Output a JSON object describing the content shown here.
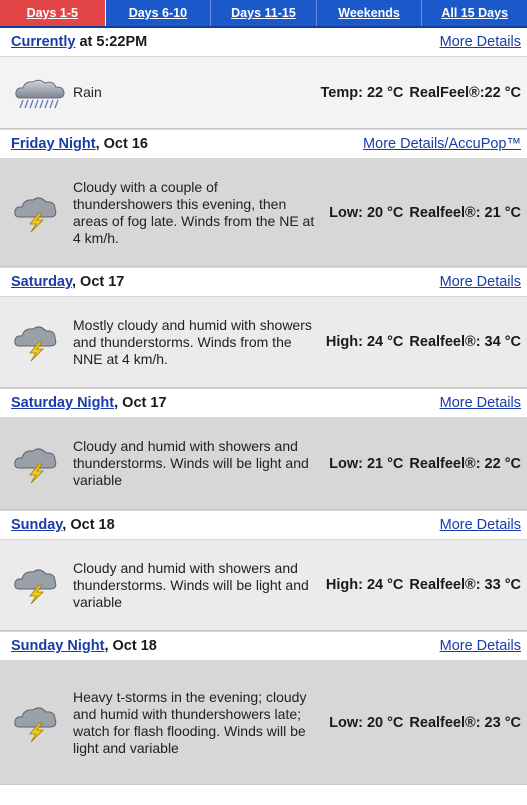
{
  "tabs": [
    {
      "label": "Days 1-5",
      "active": true
    },
    {
      "label": "Days 6-10"
    },
    {
      "label": "Days 11-15"
    },
    {
      "label": "Weekends"
    },
    {
      "label": "All 15 Days"
    }
  ],
  "current": {
    "link": "Currently",
    "time": " at 5:22PM",
    "more": "More Details",
    "icon": "rain-cloud-icon",
    "desc": "Rain",
    "temp": "Temp: 22 °C",
    "realfeel": "RealFeel®:22 °C"
  },
  "periods": [
    {
      "name": "Friday Night",
      "date": ", Oct 16",
      "more": "More Details/AccuPop™",
      "icon": "thunderstorm-cloud-icon",
      "desc": "Cloudy with a couple of thundershowers this evening, then areas of fog late. Winds from the NE at 4 km/h.",
      "temp": "Low: 20 °C",
      "realfeel": "Realfeel®: 21 °C"
    },
    {
      "name": "Saturday",
      "date": ", Oct 17",
      "more": "More Details",
      "icon": "thunderstorm-cloud-icon",
      "desc": "Mostly cloudy and humid with showers and thunderstorms. Winds from the NNE at 4 km/h.",
      "temp": "High: 24 °C",
      "realfeel": "Realfeel®: 34 °C"
    },
    {
      "name": "Saturday Night",
      "date": ", Oct 17",
      "more": "More Details",
      "icon": "thunderstorm-cloud-icon",
      "desc": "Cloudy and humid with showers and thunderstorms. Winds will be light and variable",
      "temp": "Low: 21 °C",
      "realfeel": "Realfeel®: 22 °C"
    },
    {
      "name": "Sunday",
      "date": ", Oct 18",
      "more": "More Details",
      "icon": "thunderstorm-cloud-icon",
      "desc": "Cloudy and humid with showers and thunderstorms. Winds will be light and variable",
      "temp": "High: 24 °C",
      "realfeel": "Realfeel®: 33 °C"
    },
    {
      "name": "Sunday Night",
      "date": ", Oct 18",
      "more": "More Details",
      "icon": "thunderstorm-cloud-icon",
      "desc": "Heavy t-storms in the evening; cloudy and humid with thundershowers late; watch for flash flooding. Winds will be light and variable",
      "temp": "Low: 20 °C",
      "realfeel": "Realfeel®: 23 °C"
    }
  ],
  "colors": {
    "tab_bar": "#1b58c9",
    "active_tab": "#e14545",
    "link": "#1a3ca8"
  }
}
